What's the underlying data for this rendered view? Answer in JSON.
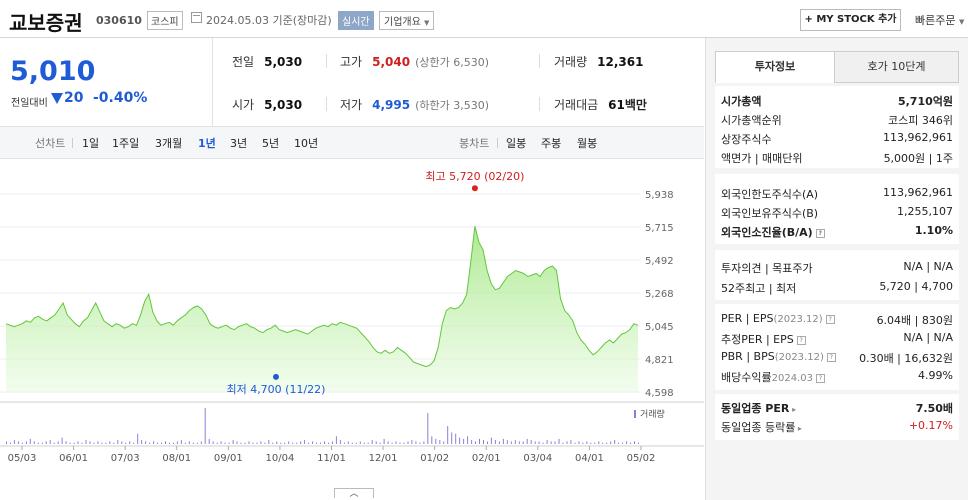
{
  "header": {
    "stock_name": "교보증권",
    "stock_code": "030610",
    "market": "코스피",
    "date_text": "2024.05.03  기준(장마감)",
    "realtime_label": "실시간",
    "company_info_label": "기업개요",
    "my_stock_label": "+ MY STOCK 추가",
    "quick_order_label": "빠른주문"
  },
  "price": {
    "current": "5,010",
    "change_label": "전일대비",
    "change": "20",
    "change_pct": "-0.40%"
  },
  "stats": {
    "prev_close_label": "전일",
    "prev_close": "5,030",
    "high_label": "고가",
    "high": "5,040",
    "upper_limit": "(상한가 6,530)",
    "volume_label": "거래량",
    "volume": "12,361",
    "open_label": "시가",
    "open": "5,030",
    "low_label": "저가",
    "low": "4,995",
    "lower_limit": "(하한가 3,530)",
    "amount_label": "거래대금",
    "amount": "61",
    "amount_unit": "백만"
  },
  "period_bar": {
    "line_chart_label": "선차트",
    "line_periods": [
      "1일",
      "1주일",
      "3개월",
      "1년",
      "3년",
      "5년",
      "10년"
    ],
    "active_period": "1년",
    "candle_chart_label": "봉차트",
    "candle_periods": [
      "일봉",
      "주봉",
      "월봉"
    ]
  },
  "chart_data": {
    "type": "area",
    "y_ticks": [
      "5,938",
      "5,715",
      "5,492",
      "5,268",
      "5,045",
      "4,821",
      "4,598"
    ],
    "ylim": [
      4598,
      5938
    ],
    "x_ticks": [
      "05/03",
      "06/01",
      "07/03",
      "08/01",
      "09/01",
      "10/04",
      "11/01",
      "12/01",
      "01/02",
      "02/01",
      "03/04",
      "04/01",
      "05/02"
    ],
    "high_annotation": "최고 5,720 (02/20)",
    "low_annotation": "최저 4,700 (11/22)",
    "high_value": 5720,
    "low_value": 4700,
    "volume_label": "거래량",
    "series": [
      {
        "values": [
          5060,
          5050,
          5040,
          5050,
          5060,
          5080,
          5070,
          5100,
          5110,
          5090,
          5080,
          5100,
          5120,
          5160,
          5200,
          5120,
          5090,
          5060,
          5040,
          5080,
          5100,
          5150,
          5200,
          5140,
          5080,
          5060,
          5040,
          5060,
          5050,
          5030,
          5040,
          5060,
          5050,
          5120,
          5210,
          5260,
          5140,
          5080,
          5050,
          5060,
          5070,
          5050,
          5080,
          5100,
          5120,
          5150,
          5170,
          5180,
          5160,
          5120,
          5060,
          5040,
          5030,
          5040,
          5050,
          5030,
          5020,
          5040,
          5050,
          5060,
          5040,
          5030,
          5010,
          5000,
          5020,
          5030,
          5050,
          5020,
          5010,
          5000,
          5010,
          5020,
          5010,
          5000,
          4990,
          5010,
          5030,
          5040,
          5050,
          5040,
          5060,
          5050,
          5070,
          5060,
          5050,
          5040,
          5030,
          5000,
          4970,
          4940,
          4900,
          4870,
          4860,
          4880,
          4860,
          4870,
          4900,
          4880,
          4860,
          4830,
          4800,
          4790,
          4780,
          4770,
          4780,
          4810,
          4900,
          5060,
          5150,
          5170,
          5160,
          5170,
          5200,
          5260,
          5480,
          5720,
          5610,
          5560,
          5420,
          5330,
          5290,
          5300,
          5340,
          5380,
          5400,
          5420,
          5410,
          5400,
          5380,
          5390,
          5400,
          5380,
          5420,
          5440,
          5450,
          5420,
          5230,
          5150,
          5120,
          5080,
          5000,
          4950,
          4920,
          4880,
          4850,
          4870,
          4900,
          4930,
          4950,
          4930,
          4960,
          4990,
          5000,
          5020,
          5060,
          5050
        ]
      }
    ],
    "volume_values": [
      2,
      1,
      3,
      2,
      1,
      2,
      4,
      2,
      1,
      1,
      2,
      3,
      1,
      2,
      5,
      2,
      1,
      1,
      2,
      1,
      3,
      2,
      1,
      2,
      1,
      1,
      2,
      1,
      3,
      2,
      1,
      2,
      1,
      8,
      3,
      2,
      1,
      2,
      1,
      1,
      2,
      1,
      1,
      2,
      3,
      1,
      2,
      1,
      1,
      2,
      28,
      4,
      2,
      1,
      2,
      1,
      1,
      3,
      2,
      1,
      1,
      2,
      1,
      1,
      2,
      1,
      3,
      1,
      2,
      1,
      1,
      2,
      1,
      1,
      2,
      3,
      1,
      2,
      1,
      1,
      2,
      1,
      2,
      6,
      3,
      1,
      2,
      1,
      1,
      2,
      1,
      1,
      3,
      2,
      1,
      4,
      2,
      1,
      2,
      1,
      1,
      2,
      3,
      2,
      1,
      2,
      24,
      6,
      4,
      3,
      2,
      14,
      9,
      8,
      5,
      4,
      6,
      3,
      2,
      4,
      3,
      2,
      5,
      3,
      2,
      4,
      3,
      2,
      3,
      2,
      2,
      4,
      3,
      2,
      2,
      1,
      3,
      2,
      2,
      4,
      1,
      2,
      3,
      1,
      2,
      1,
      2,
      1,
      1,
      2,
      1,
      1,
      2,
      3,
      1,
      1,
      2,
      1,
      2,
      1
    ]
  },
  "right_panel": {
    "tabs": [
      "투자정보",
      "호가 10단계"
    ],
    "active_tab": "투자정보",
    "g1": [
      {
        "k": "시가총액",
        "v": "5,710억원"
      },
      {
        "k": "시가총액순위",
        "v": "코스피  346위"
      },
      {
        "k": "상장주식수",
        "v": "113,962,961"
      },
      {
        "k": "액면가 | 매매단위",
        "v": "5,000원 | 1주"
      }
    ],
    "g2": [
      {
        "k": "외국인한도주식수(A)",
        "v": "113,962,961"
      },
      {
        "k": "외국인보유주식수(B)",
        "v": "1,255,107"
      },
      {
        "k": "외국인소진율(B/A)",
        "v": "1.10%"
      }
    ],
    "g3": [
      {
        "k": "투자의견 | 목표주가",
        "v": "N/A | N/A"
      },
      {
        "k": "52주최고 | 최저",
        "v": "5,720 | 4,700"
      }
    ],
    "g4": [
      {
        "k": "PER | EPS",
        "k_sub": "(2023.12)",
        "v": "6.04배 | 830원"
      },
      {
        "k": "추정PER | EPS",
        "v": "N/A | N/A"
      },
      {
        "k": "PBR | BPS",
        "k_sub": "(2023.12)",
        "v": "0.30배 | 16,632원"
      },
      {
        "k": "배당수익률",
        "k_sub": "2024.03",
        "v": "4.99%"
      }
    ],
    "g5": [
      {
        "k": "동일업종 PER",
        "v": "7.50배"
      },
      {
        "k": "동일업종 등락률",
        "v": "+0.17%"
      }
    ]
  }
}
